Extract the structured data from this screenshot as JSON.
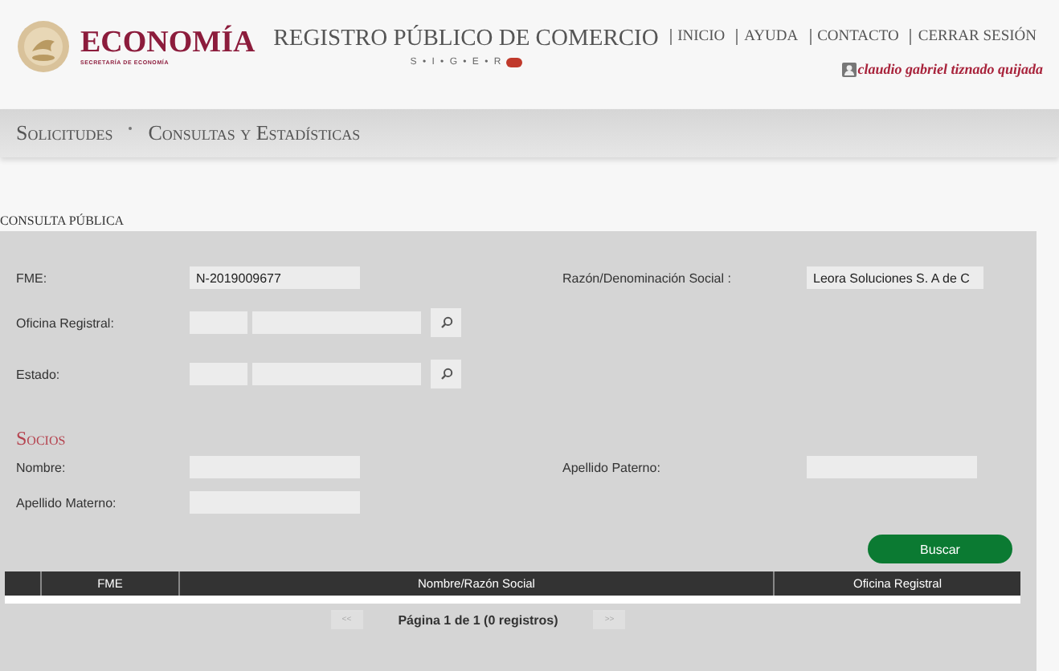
{
  "header": {
    "logo_text": "ECONOMÍA",
    "logo_subtitle": "SECRETARÍA DE ECONOMÍA",
    "title": "REGISTRO PÚBLICO DE COMERCIO",
    "subtitle": "S • I • G • E • R",
    "links": [
      "INICIO",
      "AYUDA",
      "CONTACTO",
      "CERRAR SESIÓN"
    ],
    "user": "claudio gabriel tiznado quijada"
  },
  "nav": [
    "Solicitudes",
    "Consultas y Estadísticas"
  ],
  "page_title": "CONSULTA PÚBLICA",
  "sections": [
    {
      "rows": [
        [
          {
            "label": "FME:",
            "kind": "text",
            "value": "N-2019009677"
          },
          {
            "label": "Razón/Denominación Social :",
            "kind": "text",
            "value": "Leora Soluciones S. A de C"
          }
        ],
        [
          {
            "label": "Oficina Registral:",
            "kind": "lookup"
          }
        ],
        [
          {
            "label": "Estado:",
            "kind": "lookup"
          }
        ]
      ]
    },
    {
      "title": "Socios",
      "rows": [
        [
          {
            "label": "Nombre:",
            "kind": "text"
          },
          {
            "label": "Apellido Paterno:",
            "kind": "text"
          }
        ],
        [
          {
            "label": "Apellido Materno:",
            "kind": "text"
          }
        ]
      ]
    }
  ],
  "search_button": "Buscar",
  "table": {
    "columns": [
      "FME",
      "Nombre/Razón Social",
      "Oficina Registral"
    ]
  },
  "pager": {
    "prev": "<<",
    "next": ">>",
    "text": "Página 1 de 1 (0 registros)",
    "disabled": true
  }
}
